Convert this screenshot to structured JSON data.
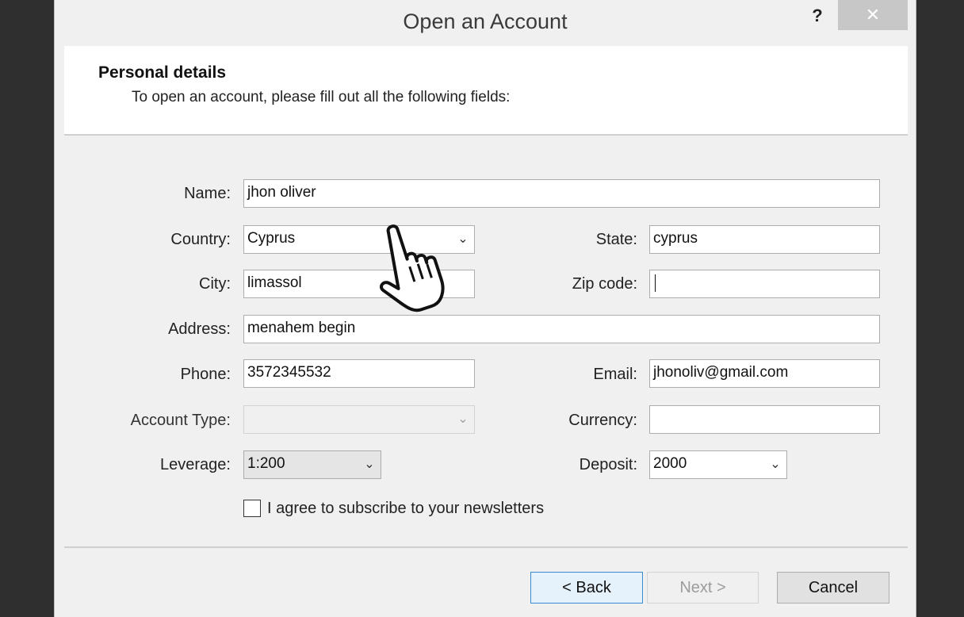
{
  "window": {
    "title": "Open an Account",
    "help_label": "?",
    "close_label": "✕"
  },
  "header": {
    "title": "Personal details",
    "subtitle": "To open an account, please fill out all the following fields:"
  },
  "form": {
    "name_label": "Name:",
    "name_value": "jhon oliver",
    "country_label": "Country:",
    "country_value": "Cyprus",
    "state_label": "State:",
    "state_value": "cyprus",
    "city_label": "City:",
    "city_value": "limassol",
    "zip_label": "Zip code:",
    "zip_value": "",
    "address_label": "Address:",
    "address_value": "menahem begin",
    "phone_label": "Phone:",
    "phone_value": "3572345532",
    "email_label": "Email:",
    "email_value": "jhonoliv@gmail.com",
    "account_type_label": "Account Type:",
    "account_type_value": "",
    "currency_label": "Currency:",
    "currency_value": "",
    "leverage_label": "Leverage:",
    "leverage_value": "1:200",
    "deposit_label": "Deposit:",
    "deposit_value": "2000",
    "newsletter_label": "I agree to subscribe to your newsletters",
    "newsletter_checked": false
  },
  "buttons": {
    "back": "< Back",
    "next": "Next >",
    "cancel": "Cancel"
  },
  "icons": {
    "dropdown": "chevron-down-icon",
    "cursor": "hand-pointer-icon"
  },
  "colors": {
    "background": "#2f2f2f",
    "dialog": "#f0f0f0",
    "primary_border": "#3b8ad6"
  }
}
